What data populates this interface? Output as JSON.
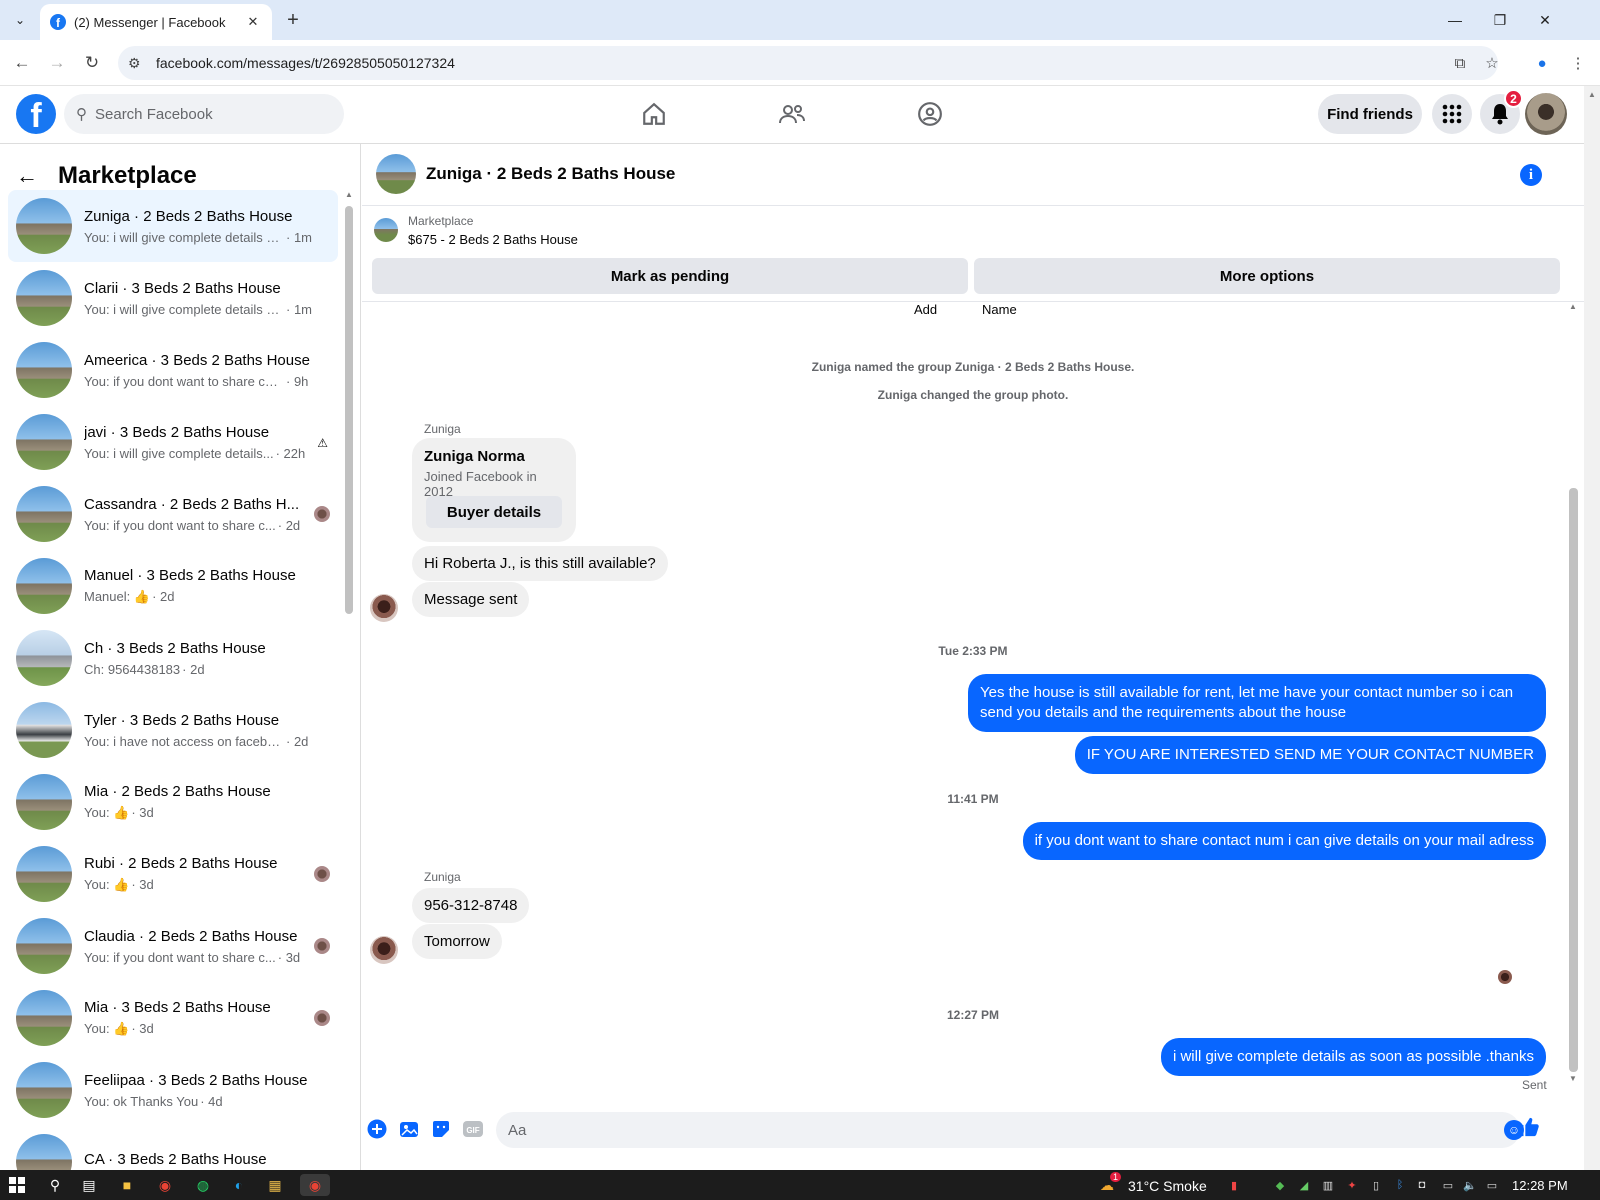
{
  "browser": {
    "tab_title": "(2) Messenger | Facebook",
    "tab_favicon": "facebook-icon",
    "url": "facebook.com/messages/t/26928505050127324"
  },
  "header": {
    "search_placeholder": "Search Facebook",
    "find_friends": "Find friends",
    "notification_count": "2",
    "nav_icons": [
      "home-icon",
      "friends-icon",
      "groups-icon"
    ]
  },
  "sidebar": {
    "title": "Marketplace",
    "conversations": [
      {
        "name": "Zuniga · 2 Beds 2 Baths House",
        "snippet": "You: i will give complete details as...",
        "time": "· 1m",
        "active": true
      },
      {
        "name": "Clarii · 3 Beds 2 Baths House",
        "snippet": "You: i will give complete details as...",
        "time": "· 1m"
      },
      {
        "name": "Ameerica · 3 Beds 2 Baths House",
        "snippet": "You: if you dont want to share cont...",
        "time": "· 9h"
      },
      {
        "name": "javi · 3 Beds 2 Baths House",
        "snippet": "You: i will give complete details...",
        "time": "· 22h"
      },
      {
        "name": "Cassandra · 2 Beds 2 Baths H...",
        "snippet": "You: if you dont want to share c...",
        "time": "· 2d"
      },
      {
        "name": "Manuel · 3 Beds 2 Baths House",
        "snippet": "Manuel: 👍",
        "time": "· 2d"
      },
      {
        "name": "Ch · 3 Beds 2 Baths House",
        "snippet": "Ch: 9564438183",
        "time": "· 2d"
      },
      {
        "name": "Tyler · 3 Beds 2 Baths House",
        "snippet": "You: i have not access on facebook...",
        "time": "· 2d"
      },
      {
        "name": "Mia · 2 Beds 2 Baths House",
        "snippet": "You: 👍",
        "time": "· 3d"
      },
      {
        "name": "Rubi · 2 Beds 2 Baths House",
        "snippet": "You: 👍",
        "time": "· 3d"
      },
      {
        "name": "Claudia · 2 Beds 2 Baths House",
        "snippet": "You: if you dont want to share c...",
        "time": "· 3d"
      },
      {
        "name": "Mia · 3 Beds 2 Baths House",
        "snippet": "You: 👍",
        "time": "· 3d"
      },
      {
        "name": "Feeliipaa · 3 Beds 2 Baths House",
        "snippet": "You: ok Thanks You",
        "time": "· 4d"
      },
      {
        "name": "CA · 3 Beds 2 Baths House",
        "snippet": "",
        "time": ""
      }
    ]
  },
  "chat": {
    "title": "Zuniga · 2 Beds 2 Baths House",
    "marketplace_label": "Marketplace",
    "listing": "$675 - 2 Beds 2 Baths House",
    "mark_pending": "Mark as pending",
    "more_options": "More options",
    "top_add": "Add",
    "top_name": "Name",
    "system_1": "Zuniga named the group Zuniga · 2 Beds 2 Baths House.",
    "system_2": "Zuniga changed the group photo.",
    "sender_1": "Zuniga",
    "card_name": "Zuniga Norma",
    "card_joined": "Joined Facebook in 2012",
    "card_button": "Buyer details",
    "in_1": "Hi Roberta J., is this still available?",
    "in_2": "Message sent",
    "ts_1": "Tue 2:33 PM",
    "out_1": "Yes the house is still available for rent, let me have your contact number so i can send you details and the requirements about the house",
    "out_2": "IF YOU ARE INTERESTED SEND ME YOUR CONTACT NUMBER",
    "ts_2": "11:41 PM",
    "out_3": "if you dont want to share contact num i can give details on your mail adress",
    "sender_2": "Zuniga",
    "in_3": "956-312-8748",
    "in_4": "Tomorrow",
    "ts_3": "12:27 PM",
    "out_4": "i will give complete details as soon as possible .thanks",
    "status": "Sent",
    "composer_placeholder": "Aa"
  },
  "taskbar": {
    "weather": "31°C  Smoke",
    "weather_badge": "1",
    "time": "12:28 PM"
  },
  "colors": {
    "accent": "#0866ff",
    "fb_blue": "#1877f2",
    "badge_red": "#e41e3f"
  }
}
